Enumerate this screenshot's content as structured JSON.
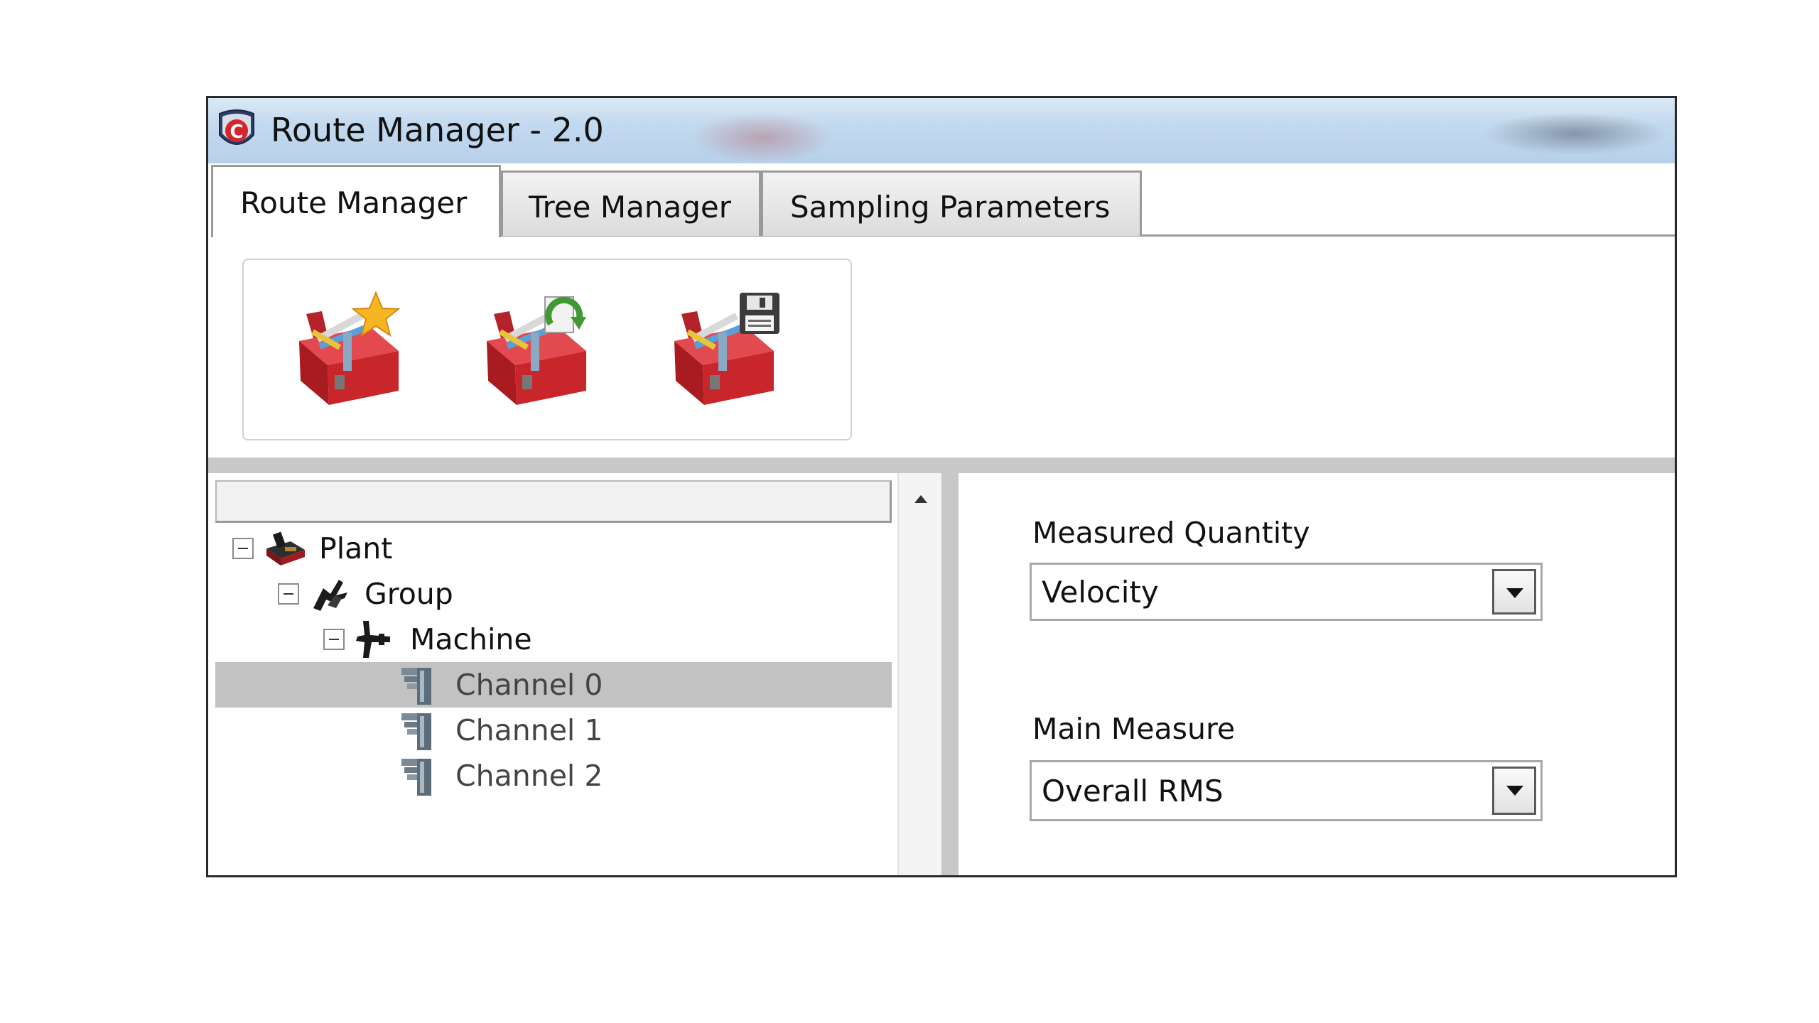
{
  "window": {
    "title": "Route Manager - 2.0"
  },
  "tabs": [
    {
      "label": "Route Manager",
      "active": true
    },
    {
      "label": "Tree Manager",
      "active": false
    },
    {
      "label": "Sampling Parameters",
      "active": false
    }
  ],
  "toolbar": {
    "buttons": [
      {
        "icon": "toolbox-new-star-icon"
      },
      {
        "icon": "toolbox-refresh-icon"
      },
      {
        "icon": "toolbox-save-icon"
      }
    ]
  },
  "tree": {
    "nodes": [
      {
        "label": "Plant",
        "icon": "plant-icon",
        "level": 0,
        "expanded": true
      },
      {
        "label": "Group",
        "icon": "group-icon",
        "level": 1,
        "expanded": true
      },
      {
        "label": "Machine",
        "icon": "machine-icon",
        "level": 2,
        "expanded": true
      },
      {
        "label": "Channel 0",
        "icon": "channel-icon",
        "level": 3,
        "selected": true
      },
      {
        "label": "Channel 1",
        "icon": "channel-icon",
        "level": 3
      },
      {
        "label": "Channel 2",
        "icon": "channel-icon",
        "level": 3
      }
    ]
  },
  "properties": {
    "measured_quantity": {
      "label": "Measured Quantity",
      "value": "Velocity"
    },
    "main_measure": {
      "label": "Main Measure",
      "value": "Overall RMS"
    }
  },
  "colors": {
    "title_bar": "#c3d9ee",
    "selected_row": "#c2c2c2",
    "splitter": "#c8c8c8",
    "toolbox_red": "#c9262b"
  }
}
